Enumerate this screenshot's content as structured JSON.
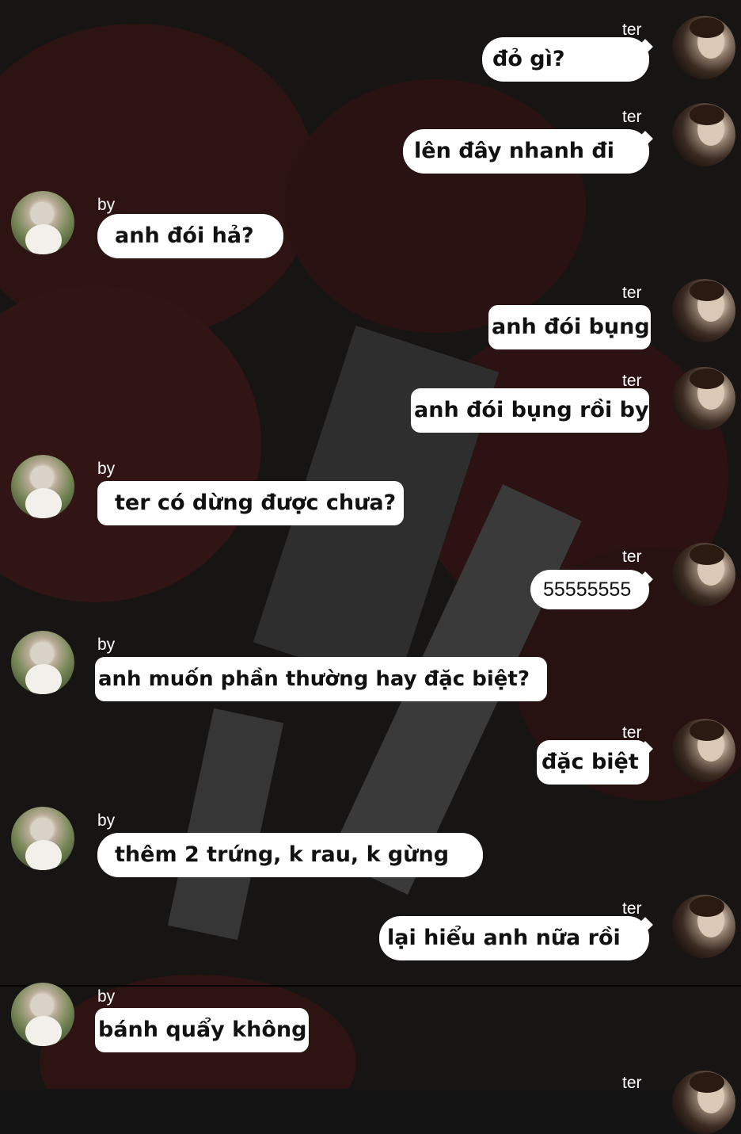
{
  "chat": {
    "messages": [
      {
        "sender": "ter",
        "text": "đỏ gì?"
      },
      {
        "sender": "ter",
        "text": "lên đây nhanh đi"
      },
      {
        "sender": "by",
        "text": "anh đói hả?"
      },
      {
        "sender": "ter",
        "text": "anh đói bụng"
      },
      {
        "sender": "ter",
        "text": "anh đói bụng rồi by"
      },
      {
        "sender": "by",
        "text": "ter có dừng được chưa?"
      },
      {
        "sender": "ter",
        "text": "55555555"
      },
      {
        "sender": "by",
        "text": "anh muốn phần thường hay đặc biệt?"
      },
      {
        "sender": "ter",
        "text": "đặc biệt"
      },
      {
        "sender": "by",
        "text": "thêm 2 trứng, k rau, k gừng"
      },
      {
        "sender": "ter",
        "text": "lại hiểu anh nữa rồi"
      },
      {
        "sender": "by",
        "text": "bánh quẩy không"
      },
      {
        "sender": "ter",
        "text": ""
      }
    ]
  },
  "colors": {
    "bubble": "#ffffff",
    "text": "#111111",
    "name": "#ffffff",
    "background": "#141414"
  },
  "icons": {
    "ter_avatar": "avatar-ter-icon",
    "by_avatar": "avatar-by-icon"
  }
}
